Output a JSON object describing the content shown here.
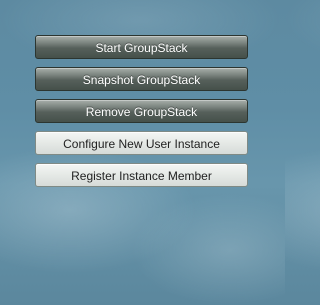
{
  "actions": {
    "start_groupstack": "Start GroupStack",
    "snapshot_groupstack": "Snapshot GroupStack",
    "remove_groupstack": "Remove GroupStack",
    "configure_new_user_instance": "Configure New User Instance",
    "register_instance_member": "Register Instance Member"
  },
  "colors": {
    "background_sky": "#5f8ea6",
    "dark_button": "#56605b",
    "light_button": "#e5e9e6"
  }
}
